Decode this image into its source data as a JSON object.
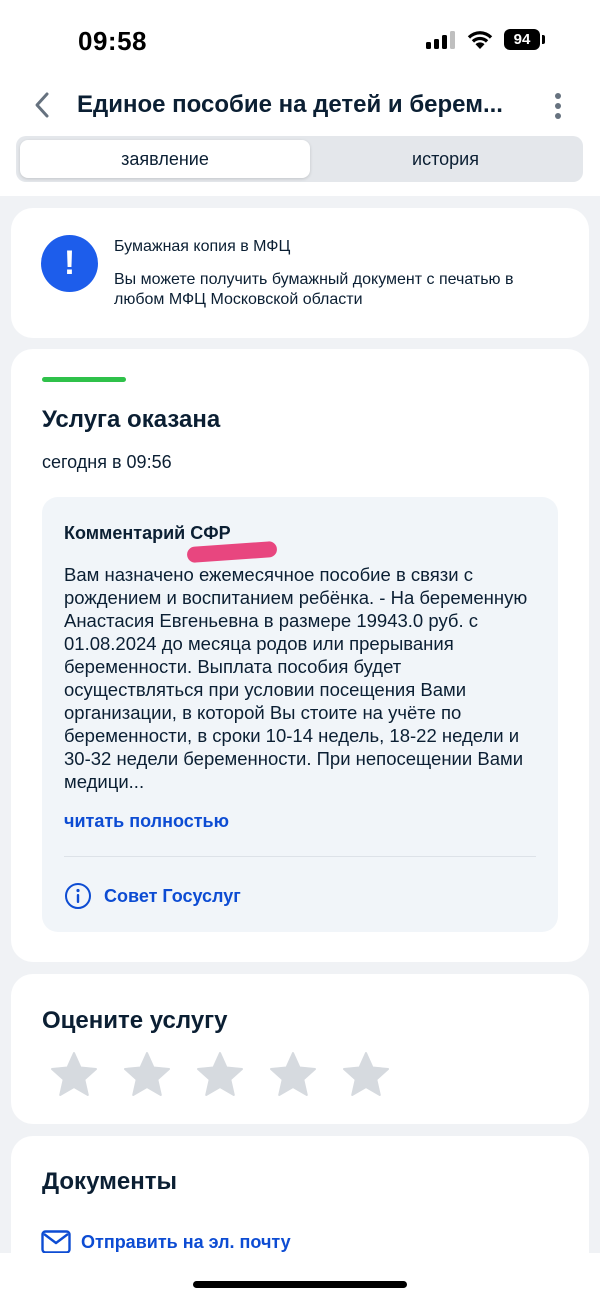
{
  "status_bar": {
    "time": "09:58",
    "battery": "94",
    "icons": [
      "signal-icon",
      "wifi-icon",
      "battery-icon"
    ]
  },
  "header": {
    "back_icon": "chevron-left-icon",
    "title": "Единое пособие на детей и берем...",
    "more_icon": "more-vertical-icon"
  },
  "tabs": [
    {
      "label": "заявление",
      "active": true
    },
    {
      "label": "история",
      "active": false
    }
  ],
  "notice": {
    "icon": "exclamation-icon",
    "title": "Бумажная копия в МФЦ",
    "text": "Вы можете получить бумажный документ с печатью в любом МФЦ Московской области"
  },
  "status": {
    "color": "#2fc14a",
    "title": "Услуга оказана",
    "date": "сегодня в 09:56",
    "comment": {
      "title": "Комментарий СФР",
      "text": "Вам назначено ежемесячное пособие в связи с рождением и воспитанием ребёнка. - На беременную Анастасия Евгеньевна в размере 19943.0 руб. с 01.08.2024 до месяца родов или прерывания беременности. Выплата пособия будет осуществляться при условии посещения Вами организации, в которой Вы стоите на учёте по беременности, в сроки 10-14 недель, 18-22 недели и 30-32 недели беременности. При непосещении Вами медици...",
      "read_more": "читать полностью",
      "advice_icon": "info-icon",
      "advice": "Совет Госуслуг"
    }
  },
  "rating": {
    "title": "Оцените услугу",
    "stars": 5,
    "selected": 0
  },
  "documents": {
    "title": "Документы",
    "email_icon": "mail-icon",
    "email_link": "Отправить на эл. почту"
  },
  "colors": {
    "accent": "#0d4cd3",
    "icon_blue": "#1d5deb",
    "success": "#2fc14a",
    "background": "#f0f2f5"
  }
}
